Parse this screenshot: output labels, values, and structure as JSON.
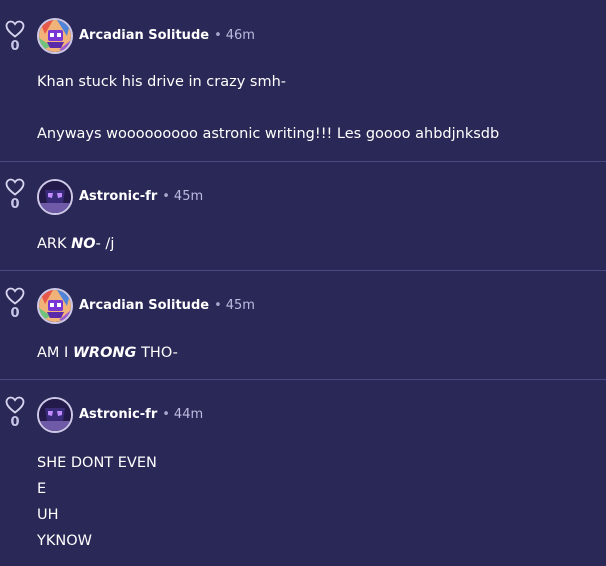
{
  "comments": [
    {
      "likes": "0",
      "username": "Arcadian Solitude",
      "separator": "•",
      "time": "46m",
      "avatar_icon": "arcadian-avatar",
      "lines": [
        "Khan stuck his drive in crazy smh-",
        "",
        "Anyways wooooooooo astronic writing!!! Les goooo ahbdjnksdb"
      ]
    },
    {
      "likes": "0",
      "username": "Astronic-fr",
      "separator": "•",
      "time": "45m",
      "avatar_icon": "astronic-avatar",
      "text_parts": [
        "ARK ",
        "NO",
        "- /j"
      ]
    },
    {
      "likes": "0",
      "username": "Arcadian Solitude",
      "separator": "•",
      "time": "45m",
      "avatar_icon": "arcadian-avatar",
      "text_parts": [
        "AM I ",
        "WRONG",
        " THO-"
      ]
    },
    {
      "likes": "0",
      "username": "Astronic-fr",
      "separator": "•",
      "time": "44m",
      "avatar_icon": "astronic-avatar",
      "lines": [
        "SHE DONT EVEN",
        "E",
        "UH",
        "YKNOW"
      ]
    }
  ],
  "colors": {
    "background": "#2a2856",
    "divider": "#4a4880",
    "text": "#ffffff",
    "muted": "#bdbbe0"
  },
  "icons": {
    "like": "heart-outline-icon"
  }
}
